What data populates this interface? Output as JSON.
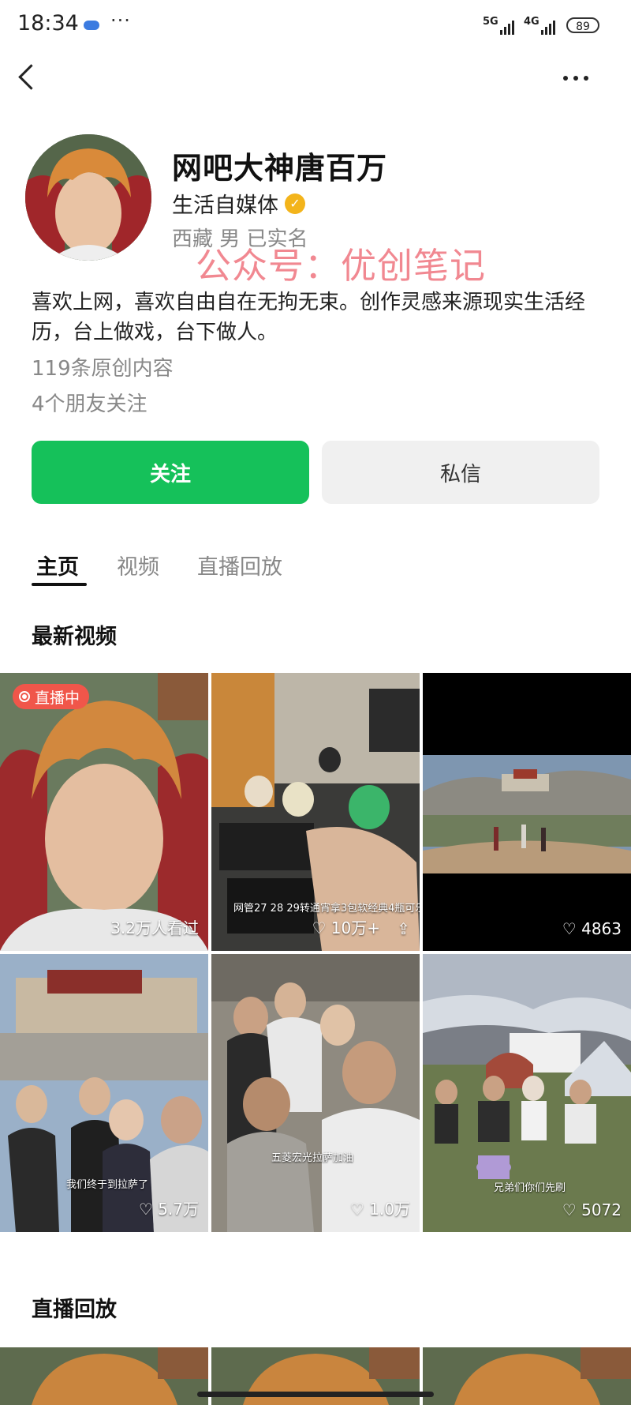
{
  "status_bar": {
    "time": "18:34",
    "dots": "···",
    "sig1": "5G",
    "sig2": "4G",
    "battery": "89"
  },
  "nav": {
    "back_icon": "chevron-left-icon",
    "more_icon": "more-dots-icon"
  },
  "profile": {
    "name": "网吧大神唐百万",
    "role": "生活自媒体",
    "meta": "西藏 男 已实名",
    "watermark": "公众号：优创笔记",
    "bio": "喜欢上网，喜欢自由自在无拘无束。创作灵感来源现实生活经历，台上做戏，台下做人。",
    "original_count": "119条原创内容",
    "friends_follow": "4个朋友关注"
  },
  "actions": {
    "follow": "关注",
    "message": "私信"
  },
  "tabs": [
    {
      "label": "主页",
      "active": true
    },
    {
      "label": "视频",
      "active": false
    },
    {
      "label": "直播回放",
      "active": false
    }
  ],
  "sections": {
    "latest": "最新视频",
    "replay": "直播回放"
  },
  "videos": [
    {
      "badge": "直播中",
      "stat": "3.2万人看过",
      "caption": ""
    },
    {
      "badge": "",
      "stat": "10万+",
      "caption": "网管27 28 29转通宵拿3包软经典4瓶可乐"
    },
    {
      "badge": "",
      "stat": "4863",
      "caption": ""
    },
    {
      "badge": "",
      "stat": "5.7万",
      "caption": "我们终于到拉萨了"
    },
    {
      "badge": "",
      "stat": "1.0万",
      "caption": "五菱宏光拉萨加油"
    },
    {
      "badge": "",
      "stat": "5072",
      "caption": "兄弟们你们先刷"
    }
  ]
}
